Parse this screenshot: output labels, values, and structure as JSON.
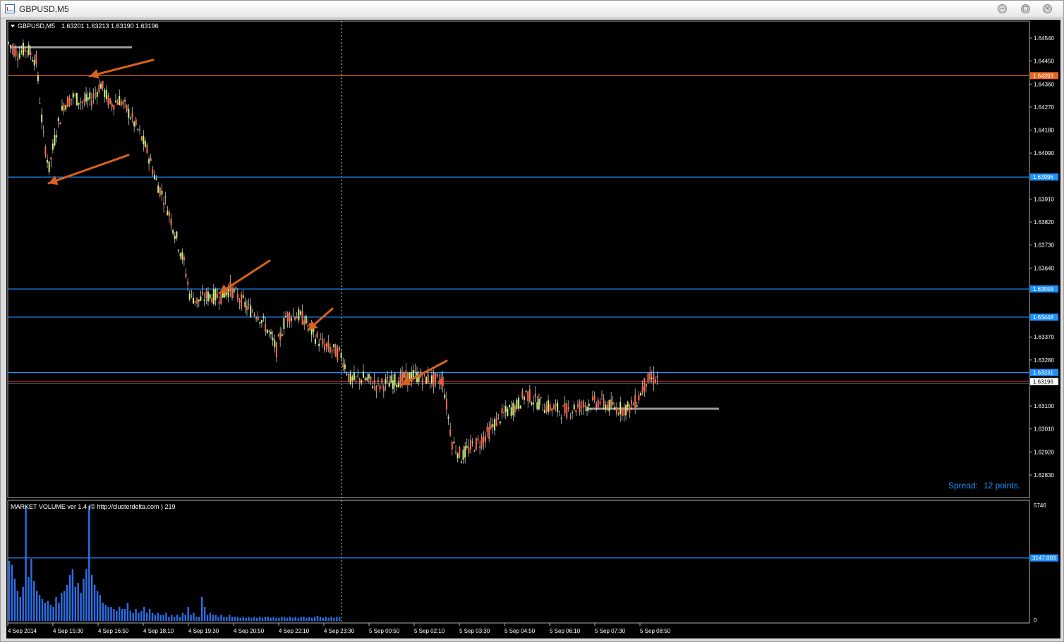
{
  "window": {
    "title": "GBPUSD,M5"
  },
  "header": {
    "symbol": "GBPUSD,M5",
    "ohlc": "1.63201 1.63213 1.63190 1.63196"
  },
  "price_axis": {
    "ticks": [
      "1.64540",
      "1.64450",
      "1.64360",
      "1.64270",
      "1.64180",
      "1.64090",
      "1.63910",
      "1.63820",
      "1.63730",
      "1.63640",
      "1.63370",
      "1.63280",
      "1.63100",
      "1.63010",
      "1.62920",
      "1.62830"
    ],
    "ticks_values": [
      1.6454,
      1.6445,
      1.6436,
      1.6427,
      1.6418,
      1.6409,
      1.6391,
      1.6382,
      1.6373,
      1.6364,
      1.6337,
      1.6328,
      1.631,
      1.6301,
      1.6292,
      1.6283
    ]
  },
  "level_lines": [
    {
      "label": "1.64393",
      "value": 1.64393,
      "color": "#e8651c"
    },
    {
      "label": "1.63996",
      "value": 1.63996,
      "color": "#1e90ff"
    },
    {
      "label": "1.63558",
      "value": 1.63558,
      "color": "#1e90ff"
    },
    {
      "label": "1.63448",
      "value": 1.63448,
      "color": "#1e90ff"
    },
    {
      "label": "1.63231",
      "value": 1.63231,
      "color": "#1e90ff"
    }
  ],
  "current_price": {
    "label": "1.63196",
    "value": 1.63196
  },
  "spread": {
    "label": "Spread:",
    "value": "12 points."
  },
  "volume": {
    "title": "MARKET VOLUME ver 1.4 (© http://clusterdelta.com ) 219",
    "max_label": "5746",
    "zero_label": "0",
    "level_label": "3147.003",
    "level_value": 3147.003,
    "max_value": 5746
  },
  "time_axis": [
    "4 Sep 2014",
    "4 Sep 15:30",
    "4 Sep 16:50",
    "4 Sep 18:10",
    "4 Sep 19:30",
    "4 Sep 20:50",
    "4 Sep 22:10",
    "4 Sep 23:30",
    "5 Sep 00:50",
    "5 Sep 02:10",
    "5 Sep 03:30",
    "5 Sep 04:50",
    "5 Sep 06:10",
    "5 Sep 07:30",
    "5 Sep 08:50"
  ],
  "price_path": [
    [
      0,
      1.6452
    ],
    [
      5,
      1.6448
    ],
    [
      10,
      1.645
    ],
    [
      15,
      1.6445
    ],
    [
      19,
      1.6415
    ],
    [
      22,
      1.6403
    ],
    [
      26,
      1.6418
    ],
    [
      30,
      1.6428
    ],
    [
      35,
      1.6431
    ],
    [
      40,
      1.6429
    ],
    [
      45,
      1.643
    ],
    [
      50,
      1.6436
    ],
    [
      55,
      1.6428
    ],
    [
      60,
      1.643
    ],
    [
      65,
      1.6425
    ],
    [
      70,
      1.6418
    ],
    [
      75,
      1.641
    ],
    [
      80,
      1.6398
    ],
    [
      85,
      1.639
    ],
    [
      90,
      1.6378
    ],
    [
      95,
      1.6366
    ],
    [
      98,
      1.6354
    ],
    [
      102,
      1.6351
    ],
    [
      108,
      1.6353
    ],
    [
      115,
      1.6353
    ],
    [
      120,
      1.6356
    ],
    [
      125,
      1.6352
    ],
    [
      130,
      1.6348
    ],
    [
      135,
      1.6346
    ],
    [
      140,
      1.634
    ],
    [
      145,
      1.6332
    ],
    [
      150,
      1.6345
    ],
    [
      155,
      1.6346
    ],
    [
      160,
      1.6344
    ],
    [
      165,
      1.6338
    ],
    [
      170,
      1.6334
    ],
    [
      175,
      1.6332
    ],
    [
      180,
      1.633
    ],
    [
      185,
      1.632
    ],
    [
      192,
      1.6321
    ],
    [
      200,
      1.6318
    ],
    [
      210,
      1.632
    ],
    [
      220,
      1.6322
    ],
    [
      230,
      1.632
    ],
    [
      235,
      1.632
    ],
    [
      240,
      1.6296
    ],
    [
      245,
      1.629
    ],
    [
      250,
      1.6294
    ],
    [
      255,
      1.6296
    ],
    [
      260,
      1.63
    ],
    [
      265,
      1.6305
    ],
    [
      270,
      1.6308
    ],
    [
      275,
      1.631
    ],
    [
      280,
      1.6315
    ],
    [
      285,
      1.6312
    ],
    [
      290,
      1.631
    ],
    [
      295,
      1.6309
    ],
    [
      300,
      1.6308
    ],
    [
      310,
      1.631
    ],
    [
      320,
      1.6312
    ],
    [
      325,
      1.631
    ],
    [
      330,
      1.6309
    ],
    [
      335,
      1.6309
    ],
    [
      340,
      1.6312
    ],
    [
      345,
      1.632
    ],
    [
      350,
      1.6321
    ],
    [
      352,
      1.632
    ]
  ],
  "volume_series": [
    3000,
    2800,
    2100,
    1500,
    1200,
    1700,
    5746,
    2200,
    3100,
    2000,
    1500,
    1300,
    1100,
    900,
    1000,
    800,
    700,
    1200,
    900,
    1400,
    1500,
    1800,
    2300,
    2600,
    1700,
    1900,
    1400,
    2100,
    2600,
    5746,
    2300,
    1800,
    1500,
    1300,
    900,
    800,
    700,
    700,
    600,
    500,
    700,
    600,
    600,
    900,
    500,
    400,
    600,
    400,
    500,
    700,
    400,
    600,
    400,
    300,
    400,
    300,
    300,
    400,
    200,
    300,
    200,
    300,
    200,
    400,
    300,
    700,
    300,
    400,
    200,
    200,
    1200,
    700,
    300,
    400,
    300,
    300,
    200,
    300,
    200,
    200,
    300,
    200,
    200,
    200,
    150,
    200,
    150,
    200,
    150,
    200,
    150,
    200,
    150,
    200,
    200,
    150,
    200,
    150,
    150,
    200,
    200,
    150,
    200,
    150,
    200,
    150,
    200,
    200,
    150,
    200,
    150,
    200,
    250,
    200,
    150,
    200,
    150,
    200,
    150,
    200,
    200
  ]
}
